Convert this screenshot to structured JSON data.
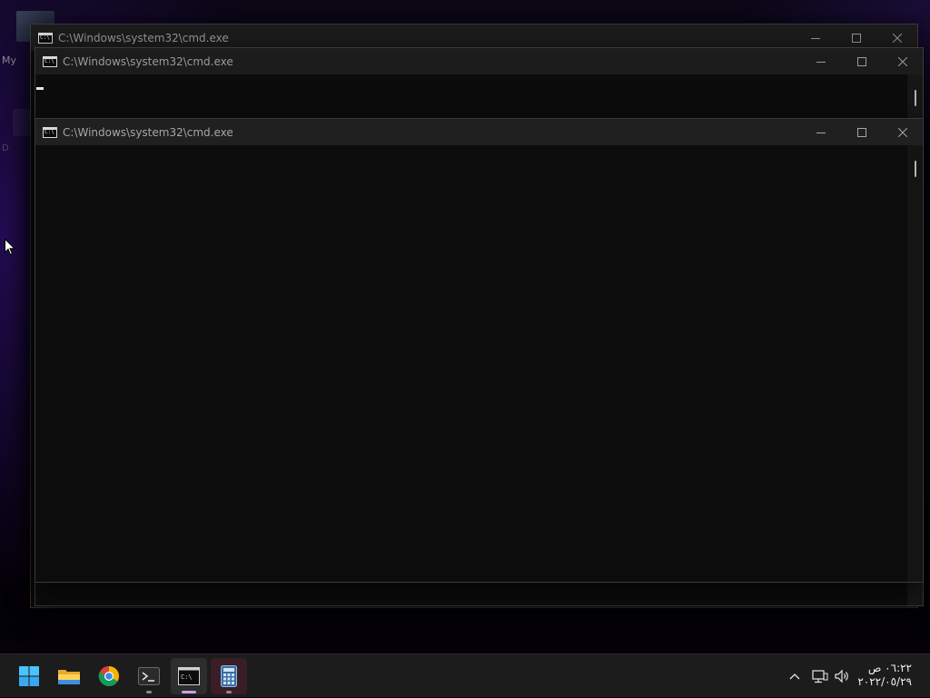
{
  "desktop": {
    "icon_label_1": "My",
    "icon_label_2": "D"
  },
  "windows": [
    {
      "title": "C:\\Windows\\system32\\cmd.exe",
      "state": "inactive"
    },
    {
      "title": "C:\\Windows\\system32\\cmd.exe",
      "state": "inactive"
    },
    {
      "title": "C:\\Windows\\system32\\cmd.exe",
      "state": "active"
    }
  ],
  "taskbar": {
    "items": [
      {
        "name": "Start",
        "icon": "windows-logo-icon"
      },
      {
        "name": "File Explorer",
        "icon": "folder-icon"
      },
      {
        "name": "Google Chrome",
        "icon": "chrome-icon"
      },
      {
        "name": "Terminal",
        "icon": "terminal-icon"
      },
      {
        "name": "Command Prompt",
        "icon": "cmd-icon"
      },
      {
        "name": "Calculator",
        "icon": "calculator-icon"
      }
    ],
    "clock_time": "٠٦:٢٢ ص",
    "clock_date": "٢٠٢٢/٠٥/٢٩"
  },
  "colors": {
    "titlebar": "#202020",
    "console_bg": "#0c0c0c",
    "taskbar": "#1c1c1c",
    "accent_indicator": "#c9a0e8"
  }
}
